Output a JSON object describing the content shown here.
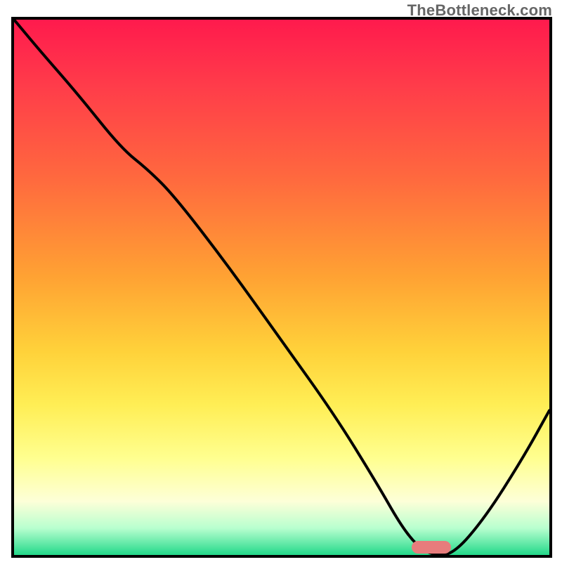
{
  "watermark": "TheBottleneck.com",
  "colors": {
    "border": "#000000",
    "curve": "#000000",
    "marker": "#e77c7c",
    "gradient_top": "#ff1a4d",
    "gradient_bottom": "#23d98a"
  },
  "chart_data": {
    "type": "line",
    "title": "",
    "xlabel": "",
    "ylabel": "",
    "xlim": [
      0,
      100
    ],
    "ylim": [
      0,
      100
    ],
    "grid": false,
    "legend": false,
    "series": [
      {
        "name": "bottleneck-curve",
        "x": [
          0,
          5,
          12,
          20,
          25,
          30,
          40,
          50,
          60,
          68,
          72,
          75,
          78,
          82,
          88,
          95,
          100
        ],
        "y": [
          100,
          94,
          86,
          76,
          72,
          67,
          54,
          40,
          26,
          13,
          6,
          2,
          0,
          0,
          7,
          18,
          27
        ]
      }
    ],
    "marker": {
      "name": "optimal-range",
      "x_center": 78,
      "y_center": 1.5,
      "approx_x_range": [
        74,
        82
      ]
    },
    "note": "Axes are untitled and unticked in the source image; x/y are normalized 0–100. y values are approximate readings of the black curve height relative to the plot area (100 = top, 0 = bottom)."
  }
}
